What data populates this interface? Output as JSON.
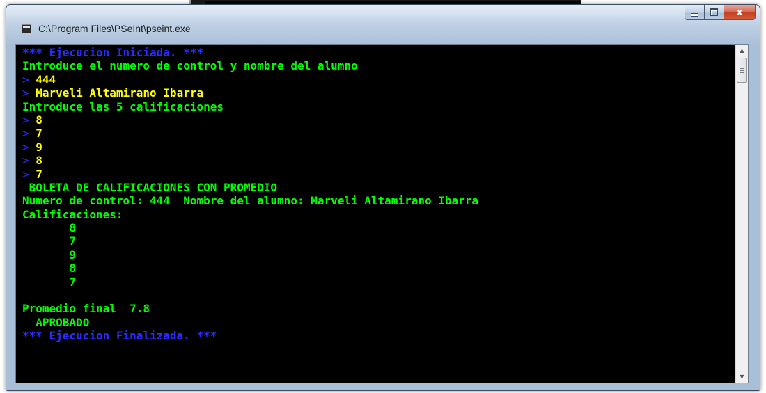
{
  "window": {
    "title": "C:\\Program Files\\PSeInt\\pseint.exe",
    "close_glyph": "x",
    "icons": [
      "console-app-icon",
      "minimize-icon",
      "maximize-icon",
      "close-icon",
      "scroll-up-icon",
      "scroll-down-icon"
    ]
  },
  "colors": {
    "console_bg": "#000000",
    "system_text": "#2b2bff",
    "program_output": "#00ff00",
    "user_input": "#ffff00"
  },
  "console": {
    "prompt_symbol": ">",
    "lines": [
      {
        "text": "*** Ejecucion Iniciada. ***",
        "kind": "system"
      },
      {
        "text": "Introduce el numero de control y nombre del alumno",
        "kind": "output"
      },
      {
        "text": " 444",
        "kind": "input"
      },
      {
        "text": " Marveli Altamirano Ibarra",
        "kind": "input"
      },
      {
        "text": "Introduce las 5 calificaciones",
        "kind": "output"
      },
      {
        "text": " 8",
        "kind": "input"
      },
      {
        "text": " 7",
        "kind": "input"
      },
      {
        "text": " 9",
        "kind": "input"
      },
      {
        "text": " 8",
        "kind": "input"
      },
      {
        "text": " 7",
        "kind": "input"
      },
      {
        "text": " BOLETA DE CALIFICACIONES CON PROMEDIO",
        "kind": "output"
      },
      {
        "text": "Numero de control: 444  Nombre del alumno: Marveli Altamirano Ibarra",
        "kind": "output"
      },
      {
        "text": "Calificaciones:",
        "kind": "output"
      },
      {
        "text": "       8",
        "kind": "output"
      },
      {
        "text": "       7",
        "kind": "output"
      },
      {
        "text": "       9",
        "kind": "output"
      },
      {
        "text": "       8",
        "kind": "output"
      },
      {
        "text": "       7",
        "kind": "output"
      },
      {
        "text": "",
        "kind": "output"
      },
      {
        "text": "Promedio final  7.8",
        "kind": "output"
      },
      {
        "text": "  APROBADO",
        "kind": "output"
      },
      {
        "text": "*** Ejecucion Finalizada. ***",
        "kind": "system"
      }
    ]
  }
}
